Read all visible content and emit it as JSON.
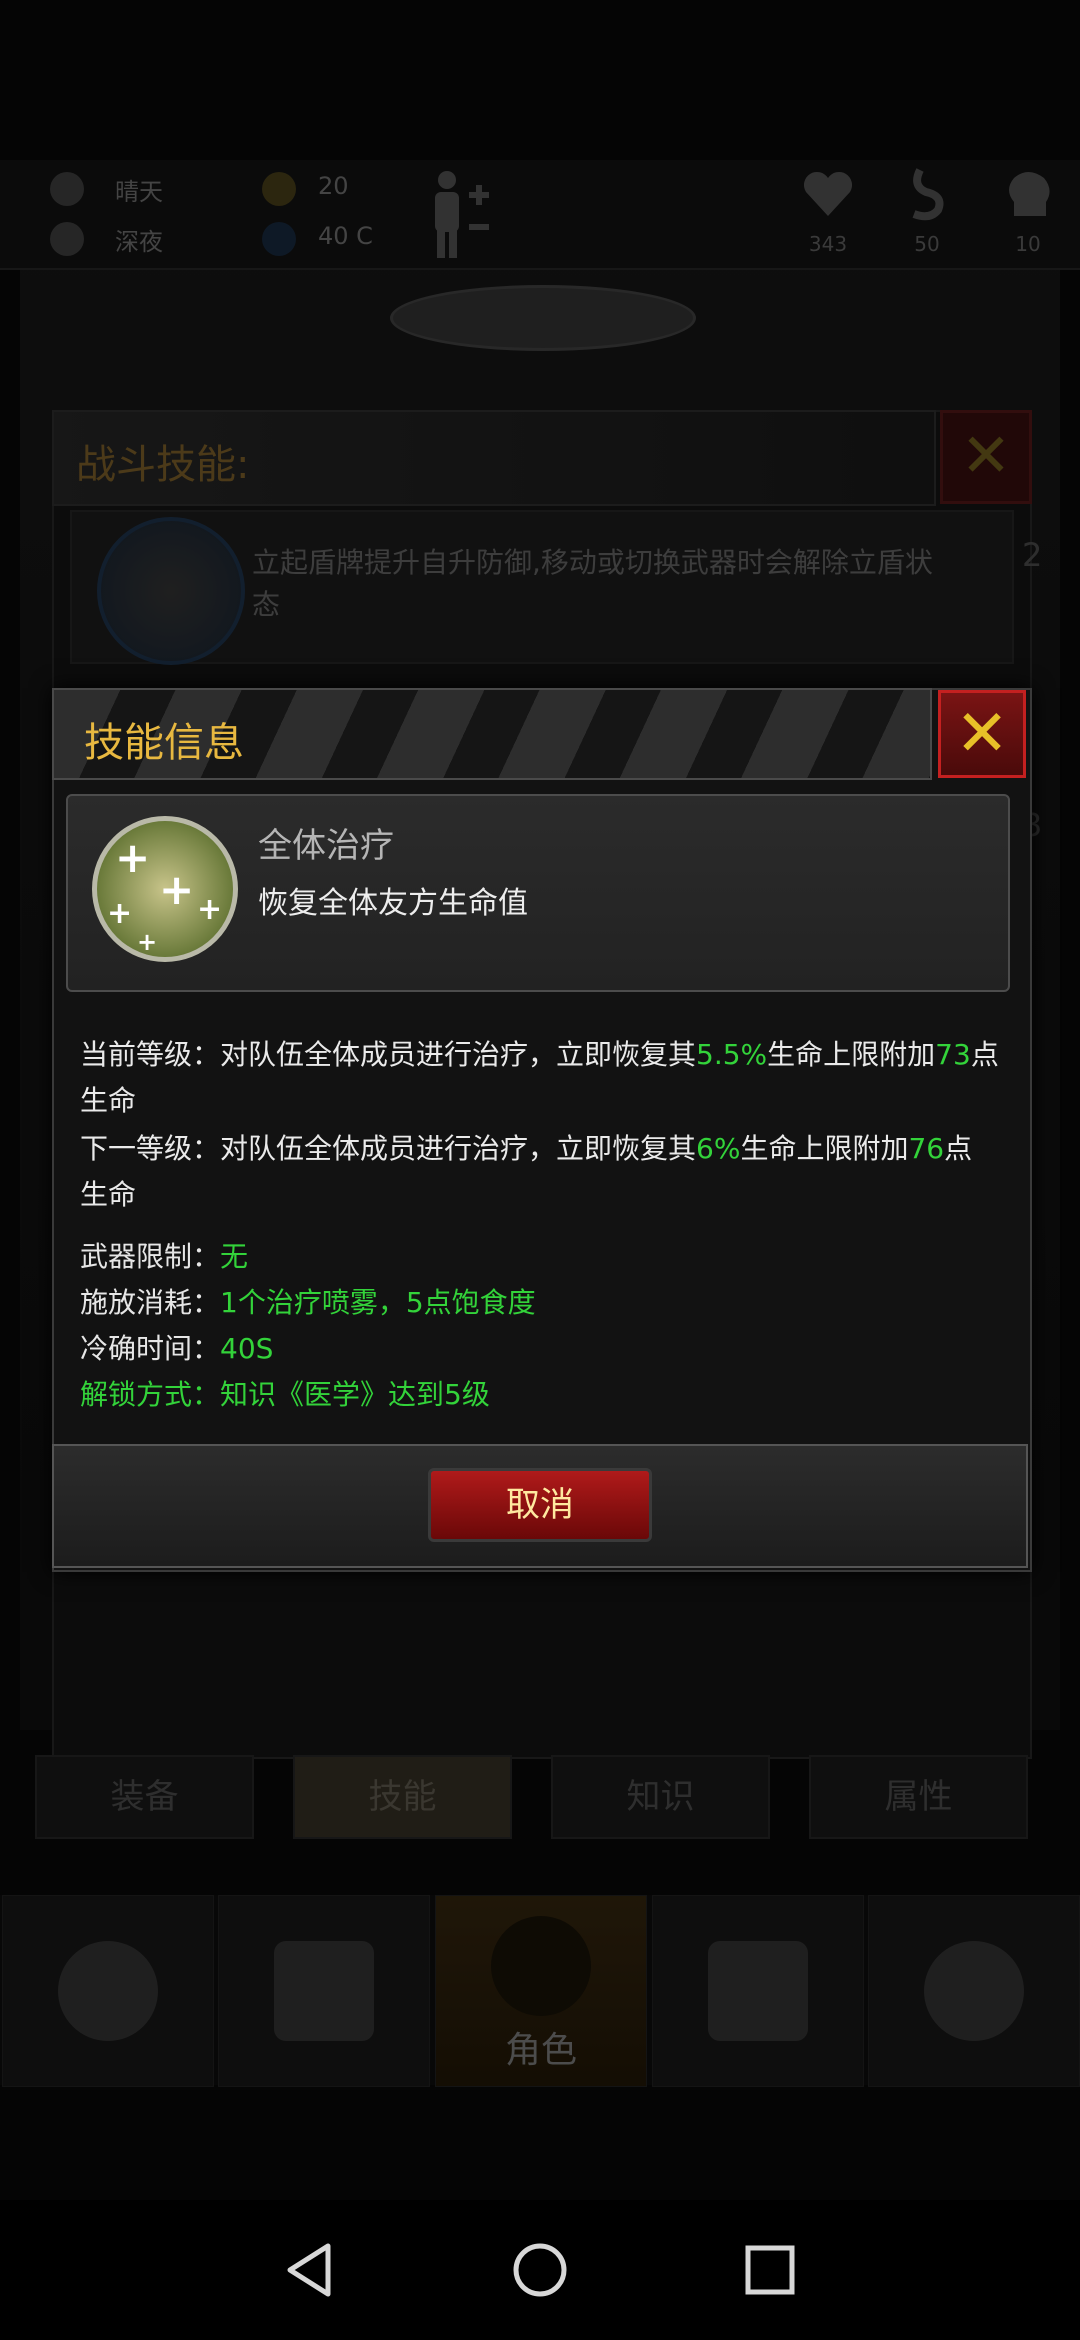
{
  "status": {
    "weather": "晴天",
    "time_of_day": "深夜",
    "radiation": "20",
    "temperature": "40 C",
    "health": "343",
    "hunger": "50",
    "mood": "10"
  },
  "background_panel": {
    "title": "战斗技能:",
    "shield_desc": "立起盾牌提升自升防御,移动或切换武器时会解除立盾状态",
    "side_num_top": "2",
    "side_num_bottom": "3"
  },
  "tabs": [
    "装备",
    "技能",
    "知识",
    "属性"
  ],
  "active_tab": 1,
  "bottom_nav": {
    "active_label": "角色",
    "icons": [
      "globe-icon",
      "suitcase-icon",
      "character-icon",
      "transfer-icon",
      "cart-icon"
    ]
  },
  "modal": {
    "title": "技能信息",
    "skill_name": "全体治疗",
    "skill_desc": "恢复全体友方生命值",
    "current_level": {
      "prefix": "当前等级：对队伍全体成员进行治疗，立即恢复其",
      "pct": "5.5%",
      "mid": "生命上限附加",
      "value": "73",
      "suffix_a": "点",
      "suffix_b": "生命"
    },
    "next_level": {
      "prefix": "下一等级：对队伍全体成员进行治疗，立即恢复其",
      "pct": "6%",
      "mid": "生命上限附加",
      "value": "76",
      "suffix_a": "点",
      "suffix_b": "生命"
    },
    "weapon_limit_label": "武器限制：",
    "weapon_limit_value": "无",
    "cost_label": "施放消耗：",
    "cost_value": "1个治疗喷雾，5点饱食度",
    "cooldown_label": "冷确时间：",
    "cooldown_value": "40S",
    "unlock": "解锁方式：知识《医学》达到5级",
    "cancel_label": "取消"
  },
  "colors": {
    "highlight_green": "#33d33a",
    "title_gold": "#e8b840",
    "cancel_red": "#b01a1a"
  }
}
